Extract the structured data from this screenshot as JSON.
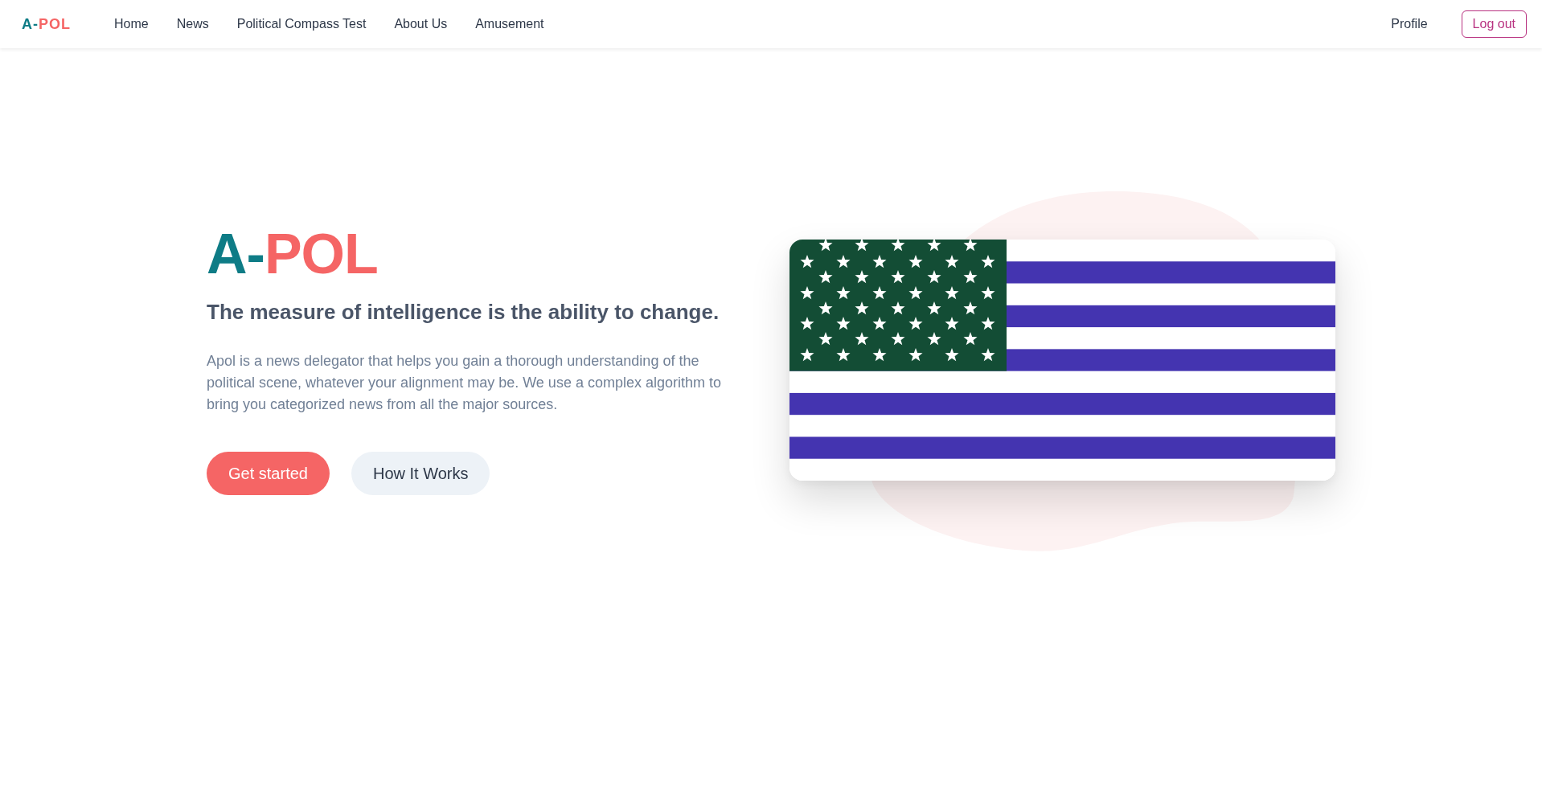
{
  "navbar": {
    "logo": [
      {
        "text": "A-",
        "color": "#0e7c86"
      },
      {
        "text": "POL",
        "color": "#f56565"
      }
    ],
    "links": [
      "Home",
      "News",
      "Political Compass Test",
      "About Us",
      "Amusement"
    ],
    "profile": "Profile",
    "logout": "Log out"
  },
  "hero": {
    "title": [
      {
        "text": "A-",
        "color": "#0e7c86"
      },
      {
        "text": "POL",
        "color": "#f56565"
      }
    ],
    "tagline": "The measure of intelligence is the ability to change.",
    "description": "Apol is a news delegator that helps you gain a thorough understanding of the political scene, whatever your alignment may be. We use a complex algorithm to bring you categorized news from all the major sources.",
    "buttons": [
      {
        "label": "Get started",
        "kind": "primary"
      },
      {
        "label": "How It Works",
        "kind": "secondary"
      }
    ]
  }
}
